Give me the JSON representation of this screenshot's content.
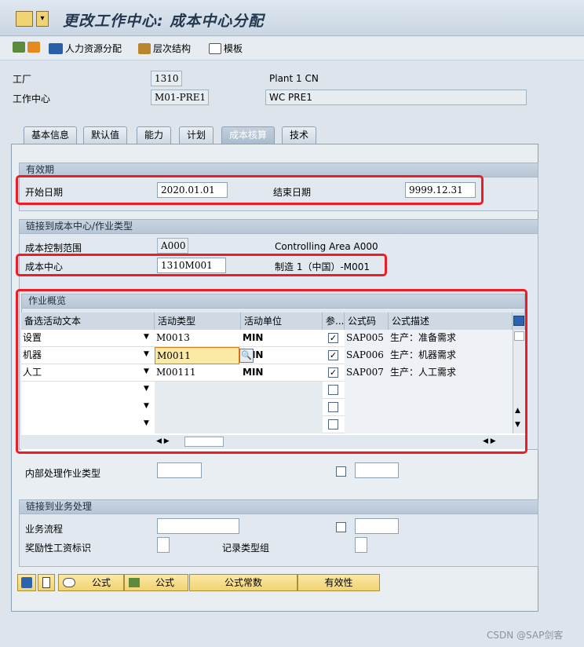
{
  "window": {
    "title": "更改工作中心: 成本中心分配"
  },
  "toolbar": {
    "hr_label": "人力资源分配",
    "hierarchy_label": "层次结构",
    "template_label": "模板"
  },
  "header": {
    "plant_label": "工厂",
    "plant_value": "1310",
    "plant_desc": "Plant 1 CN",
    "workcenter_label": "工作中心",
    "workcenter_value": "M01-PRE1",
    "workcenter_desc": "WC PRE1"
  },
  "tabs": [
    {
      "label": "基本信息"
    },
    {
      "label": "默认值"
    },
    {
      "label": "能力"
    },
    {
      "label": "计划"
    },
    {
      "label": "成本核算"
    },
    {
      "label": "技术"
    }
  ],
  "validity": {
    "title": "有效期",
    "start_label": "开始日期",
    "start_value": "2020.01.01",
    "end_label": "结束日期",
    "end_value": "9999.12.31"
  },
  "cost_center": {
    "title": "链接到成本中心/作业类型",
    "area_label": "成本控制范围",
    "area_value": "A000",
    "area_desc": "Controlling Area A000",
    "cc_label": "成本中心",
    "cc_value": "1310M001",
    "cc_desc": "制造 1（中国）-M001"
  },
  "activity": {
    "title": "作业概览",
    "columns": [
      "备选活动文本",
      "活动类型",
      "活动单位",
      "参...",
      "公式码",
      "公式描述"
    ],
    "rows": [
      {
        "text": "设置",
        "type": "M0013",
        "unit": "MIN",
        "checked": true,
        "formula": "SAP005",
        "desc": "生产：准备需求"
      },
      {
        "text": "机器",
        "type": "M0011",
        "unit": "MIN",
        "checked": true,
        "formula": "SAP006",
        "desc": "生产：机器需求"
      },
      {
        "text": "人工",
        "type": "M00111",
        "unit": "MIN",
        "checked": true,
        "formula": "SAP007",
        "desc": "生产：人工需求"
      },
      {
        "text": "",
        "type": "",
        "unit": "",
        "checked": false,
        "formula": "",
        "desc": ""
      },
      {
        "text": "",
        "type": "",
        "unit": "",
        "checked": false,
        "formula": "",
        "desc": ""
      },
      {
        "text": "",
        "type": "",
        "unit": "",
        "checked": false,
        "formula": "",
        "desc": ""
      }
    ]
  },
  "internal": {
    "label": "内部处理作业类型"
  },
  "business": {
    "title": "链接到业务处理",
    "process_label": "业务流程",
    "incentive_label": "奖励性工资标识",
    "record_label": "记录类型组"
  },
  "buttons": {
    "formula1": "公式",
    "formula2": "公式",
    "constants": "公式常数",
    "validity": "有效性"
  },
  "watermark": "CSDN @SAP剑客",
  "colors": {
    "highlight_red": "#ee1c24",
    "accent_yellow": "#f1d373"
  }
}
